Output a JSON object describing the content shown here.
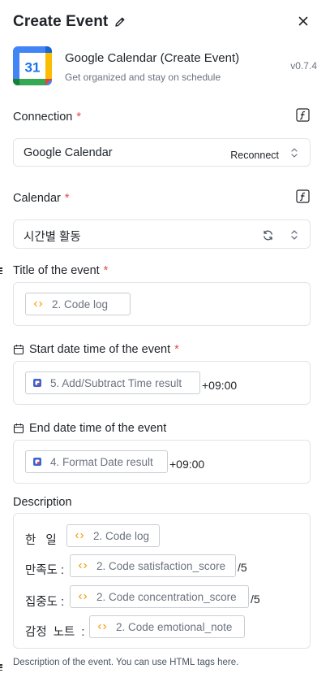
{
  "header": {
    "title": "Create Event"
  },
  "app": {
    "name": "Google Calendar (Create Event)",
    "description": "Get organized and stay on schedule",
    "version": "v0.7.4",
    "logo_text": "31"
  },
  "connection": {
    "label": "Connection",
    "required_mark": "*",
    "value": "Google Calendar",
    "reconnect_label": "Reconnect"
  },
  "calendar": {
    "label": "Calendar",
    "required_mark": "*",
    "value": "시간별 활동"
  },
  "title_field": {
    "label": "Title of the event",
    "required_mark": "*",
    "pill": "2. Code log"
  },
  "start_field": {
    "label": "Start date time of the event",
    "required_mark": "*",
    "pill": "5. Add/Subtract Time result",
    "suffix": "+09:00"
  },
  "end_field": {
    "label": "End date time of the event",
    "pill": "4. Format Date result",
    "suffix": "+09:00"
  },
  "description": {
    "label": "Description",
    "rows": [
      {
        "prefix": "한 일 :",
        "pill": "2. Code log",
        "suffix": ""
      },
      {
        "prefix": "만족도 :",
        "pill": "2. Code satisfaction_score",
        "suffix": "/5"
      },
      {
        "prefix": "집중도 :",
        "pill": "2. Code concentration_score",
        "suffix": "/5"
      },
      {
        "prefix": "감정 노트 :",
        "pill": "2. Code emotional_note",
        "suffix": ""
      }
    ],
    "help": "Description of the event. You can use HTML tags here."
  },
  "icons": {
    "pencil": "pencil-icon",
    "close": "close-icon",
    "formula": "formula-icon",
    "chevrons": "chevron-updown-icon",
    "refresh": "refresh-icon",
    "calendar": "calendar-icon",
    "code": "code-icon",
    "module": "module-icon"
  },
  "colors": {
    "required": "#e5484d",
    "border": "#e1e4e8",
    "muted_text": "#6b7280"
  }
}
